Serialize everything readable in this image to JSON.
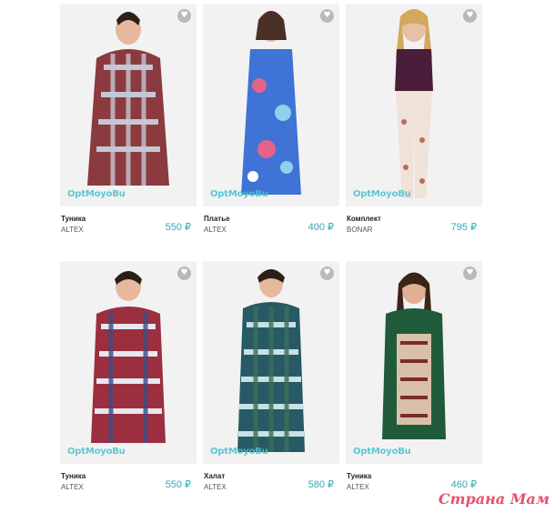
{
  "products": [
    {
      "name": "Туника",
      "brand": "ALTEX",
      "price": "550 ₽",
      "logo": "OptMoyoBu",
      "fav_icon": "heart-icon",
      "colors": [
        "#8b3a3f",
        "#c4c7d4",
        "#b89a8e"
      ]
    },
    {
      "name": "Платье",
      "brand": "ALTEX",
      "price": "400 ₽",
      "logo": "OptMoyoBu",
      "fav_icon": "heart-icon",
      "colors": [
        "#3f73d6",
        "#8fd0ea",
        "#e5628b"
      ]
    },
    {
      "name": "Комплект",
      "brand": "BONAR",
      "price": "795 ₽",
      "logo": "OptMoyoBu",
      "fav_icon": "heart-icon",
      "colors": [
        "#4a1d3b",
        "#efe2d9",
        "#b76d5b"
      ]
    },
    {
      "name": "Туника",
      "brand": "ALTEX",
      "price": "550 ₽",
      "logo": "OptMoyoBu",
      "fav_icon": "heart-icon",
      "colors": [
        "#9b2f3f",
        "#e8e6ef",
        "#3d4c82"
      ]
    },
    {
      "name": "Халат",
      "brand": "ALTEX",
      "price": "580 ₽",
      "logo": "OptMoyoBu",
      "fav_icon": "heart-icon",
      "colors": [
        "#275a66",
        "#c8e1e6",
        "#3b6e56"
      ]
    },
    {
      "name": "Туника",
      "brand": "ALTEX",
      "price": "460 ₽",
      "logo": "OptMoyoBu",
      "fav_icon": "heart-icon",
      "colors": [
        "#1f5a3b",
        "#d9c1a9",
        "#7a2b2c"
      ]
    }
  ],
  "watermark": "Страна Мам"
}
